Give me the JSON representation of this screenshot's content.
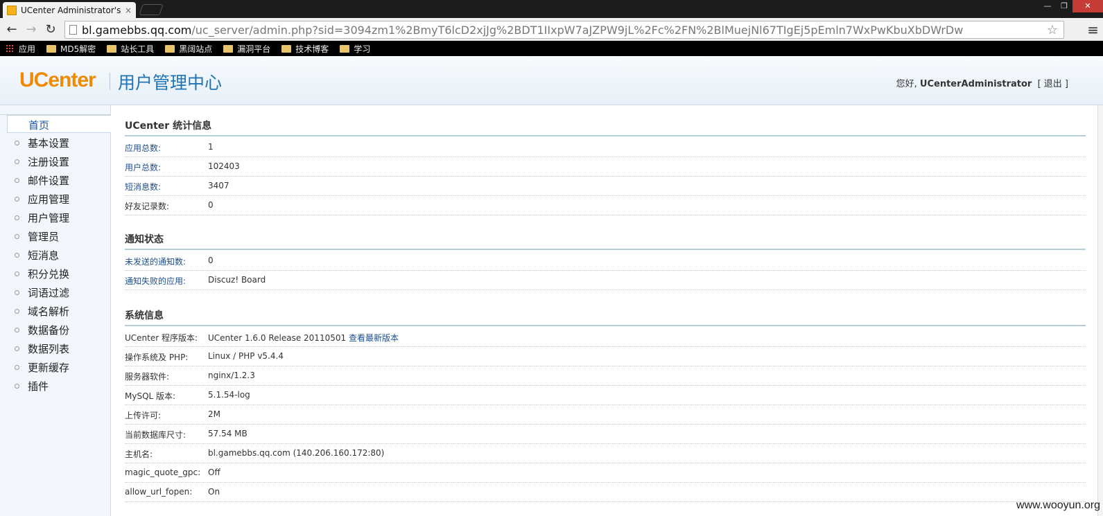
{
  "browser": {
    "tab_title": "UCenter Administrator's",
    "tab_close": "×",
    "url_host": "bl.gamebbs.qq.com",
    "url_path": "/uc_server/admin.php?sid=3094zm1%2BmyT6lcD2xjJg%2BDT1IIxpW7aJZPW9jL%2Fc%2FN%2BlMuejNl67TIgEj5pEmln7WxPwKbuXbDWrDw",
    "bookmarks": [
      "应用",
      "MD5解密",
      "站长工具",
      "黑阔站点",
      "漏洞平台",
      "技术博客",
      "学习"
    ]
  },
  "header": {
    "logo": "UCenter",
    "site_title": "用户管理中心",
    "greeting": "您好, ",
    "username": "UCenterAdministrator",
    "logout": "[ 退出 ]"
  },
  "sidebar": {
    "items": [
      {
        "label": "首页",
        "active": true
      },
      {
        "label": "基本设置"
      },
      {
        "label": "注册设置"
      },
      {
        "label": "邮件设置"
      },
      {
        "label": "应用管理"
      },
      {
        "label": "用户管理"
      },
      {
        "label": "管理员"
      },
      {
        "label": "短消息"
      },
      {
        "label": "积分兑换"
      },
      {
        "label": "词语过滤"
      },
      {
        "label": "域名解析"
      },
      {
        "label": "数据备份"
      },
      {
        "label": "数据列表"
      },
      {
        "label": "更新缓存"
      },
      {
        "label": "插件"
      }
    ]
  },
  "sections": [
    {
      "title": "UCenter 统计信息",
      "rows": [
        {
          "key": "应用总数:",
          "value": "1"
        },
        {
          "key": "用户总数:",
          "value": "102403"
        },
        {
          "key": "短消息数:",
          "value": "3407"
        },
        {
          "key": "好友记录数:",
          "value": "0"
        }
      ]
    },
    {
      "title": "通知状态",
      "rows": [
        {
          "key": "未发送的通知数:",
          "value": "0"
        },
        {
          "key": "通知失败的应用:",
          "value": "Discuz! Board"
        }
      ]
    },
    {
      "title": "系统信息",
      "rows": [
        {
          "key": "UCenter 程序版本:",
          "value": "UCenter 1.6.0 Release 20110501",
          "link": "查看最新版本"
        },
        {
          "key": "操作系统及 PHP:",
          "value": "Linux / PHP v5.4.4"
        },
        {
          "key": "服务器软件:",
          "value": "nginx/1.2.3"
        },
        {
          "key": "MySQL 版本:",
          "value": "5.1.54-log"
        },
        {
          "key": "上传许可:",
          "value": "2M"
        },
        {
          "key": "当前数据库尺寸:",
          "value": "57.54 MB"
        },
        {
          "key": "主机名:",
          "value": "bl.gamebbs.qq.com (140.206.160.172:80)"
        },
        {
          "key": "magic_quote_gpc:",
          "value": "Off"
        },
        {
          "key": "allow_url_fopen:",
          "value": "On"
        }
      ]
    }
  ],
  "watermark": "www.wooyun.org",
  "colors": {
    "accent": "#1e74b4",
    "logo": "#f08a00",
    "link": "#1e4f8c"
  }
}
